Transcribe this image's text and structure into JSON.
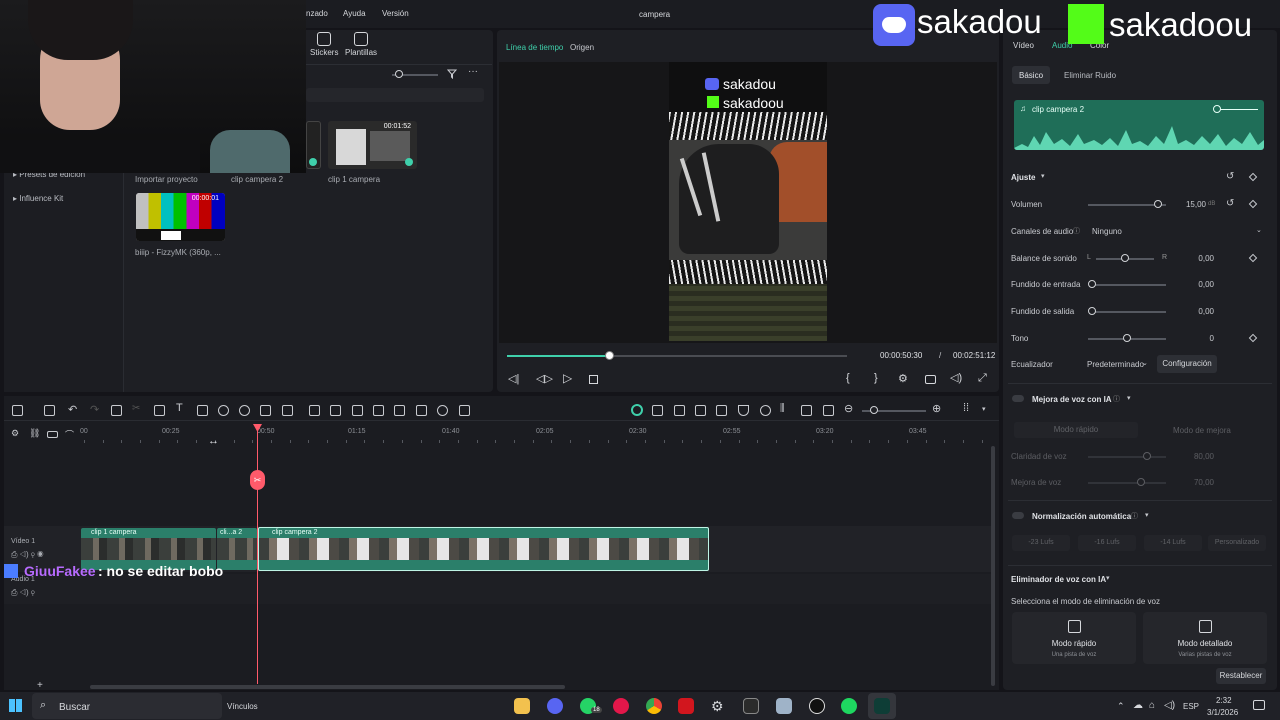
{
  "window": {
    "title": "campera"
  },
  "menu": [
    "nzado",
    "Ayuda",
    "Versión"
  ],
  "media_toolbar": {
    "stickers": "Stickers",
    "templates": "Plantillas"
  },
  "sidebar": {
    "items": [
      "Presets de edición",
      "Influence Kit"
    ]
  },
  "media": {
    "items": [
      {
        "caption": "Importar proyecto"
      },
      {
        "caption": "clip campera 2"
      },
      {
        "caption": "clip 1 campera",
        "duration": "00:01:52"
      },
      {
        "caption": "biiip - FizzyMK (360p, ...",
        "duration": "00:00:01"
      }
    ]
  },
  "player": {
    "tabs": [
      "Línea de tiempo",
      "Origen"
    ],
    "current_time": "00:00:50:30",
    "separator": "/",
    "total_time": "00:02:51:12",
    "progress": 0.3,
    "overlay_lines": [
      "sakadou",
      "sakadoou"
    ]
  },
  "props": {
    "top_tabs": [
      "Vídeo",
      "Audio",
      "Color"
    ],
    "sub_tabs": [
      "Básico",
      "Eliminar Ruido"
    ],
    "clip_name": "clip campera 2",
    "adjust": "Ajuste",
    "volume_label": "Volumen",
    "volume_value": "15,00",
    "volume_unit": "dB",
    "channels_label": "Canales de audio",
    "channels_value": "Ninguno",
    "balance_label": "Balance de sonido",
    "balance_l": "L",
    "balance_r": "R",
    "balance_value": "0,00",
    "fadein_label": "Fundido de entrada",
    "fadein_value": "0,00",
    "fadeout_label": "Fundido  de salida",
    "fadeout_value": "0,00",
    "tone_label": "Tono",
    "tone_value": "0",
    "eq_label": "Ecualizador",
    "eq_value": "Predeterminado",
    "eq_button": "Configuración",
    "voice_ai": "Mejora de voz con IA",
    "mode_fast": "Modo rápido",
    "mode_enhance": "Modo de mejora",
    "clarity_label": "Claridad de voz",
    "clarity_value": "80,00",
    "improve_label": "Mejora de voz",
    "improve_value": "70,00",
    "auto_norm": "Normalización automática",
    "lufs": [
      "-23 Lufs",
      "-16 Lufs",
      "-14 Lufs",
      "Personalizado"
    ],
    "remover": "Eliminador de voz con IA",
    "remover_desc": "Selecciona el modo de eliminación de voz",
    "card_fast_title": "Modo rápido",
    "card_fast_desc": "Una pista de voz",
    "card_detail_title": "Modo detallado",
    "card_detail_desc": "Varias pistas de voz",
    "reset": "Restablecer"
  },
  "timeline": {
    "ruler": [
      "00",
      "00:25",
      "00:50",
      "01:15",
      "01:40",
      "02:05",
      "02:30",
      "02:55",
      "03:20",
      "03:45"
    ],
    "clips": [
      "clip 1 campera",
      "cli...a 2",
      "clip campera 2"
    ],
    "track_video": "Vídeo 1",
    "track_audio": "Audio 1"
  },
  "overlays": {
    "discord_name": "sakadou",
    "kick_name": "sakadoou",
    "chat_user": "GiuuFakee",
    "chat_msg": ": no se editar bobo"
  },
  "taskbar": {
    "search": "Buscar",
    "links": "Vínculos",
    "lang": "ESP",
    "time": "2:32",
    "date": "3/1/2026",
    "whatsapp_badge": "18"
  },
  "colors": {
    "accent": "#3fd0ab",
    "clip": "#2b7f6a",
    "playhead": "#ff5a6a"
  }
}
